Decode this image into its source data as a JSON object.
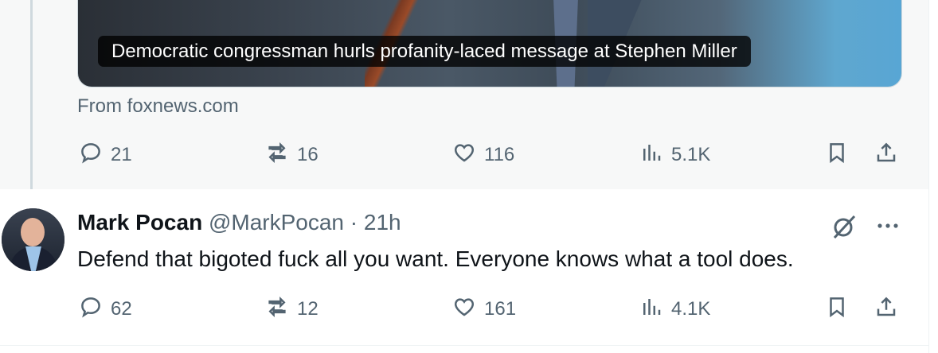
{
  "parent_tweet": {
    "card_caption": "Democratic congressman hurls profanity-laced message at Stephen Miller",
    "source": "From foxnews.com",
    "actions": {
      "replies": "21",
      "reposts": "16",
      "likes": "116",
      "views": "5.1K"
    }
  },
  "reply_tweet": {
    "author_name": "Mark Pocan",
    "author_handle": "@MarkPocan",
    "separator": "·",
    "time": "21h",
    "text": "Defend that bigoted fuck all you want. Everyone knows what a tool does.",
    "actions": {
      "replies": "62",
      "reposts": "12",
      "likes": "161",
      "views": "4.1K"
    }
  },
  "icons": {
    "reply": "reply-icon",
    "repost": "repost-icon",
    "like": "heart-icon",
    "views": "views-icon",
    "bookmark": "bookmark-icon",
    "share": "share-icon",
    "grok": "grok-icon",
    "more": "more-icon"
  },
  "colors": {
    "text_primary": "#0f1419",
    "text_secondary": "#536471",
    "parent_background": "#f7f8f8",
    "thread_line": "#cfd9de"
  }
}
